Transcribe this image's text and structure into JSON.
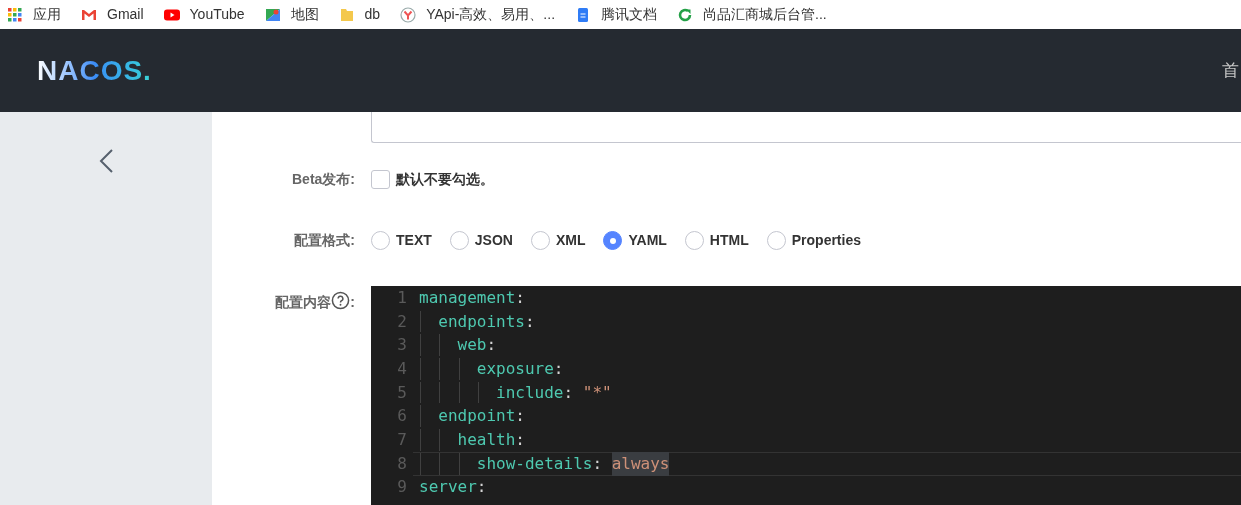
{
  "bookmarks": [
    {
      "label": "应用",
      "kind": "apps"
    },
    {
      "label": "Gmail",
      "kind": "gmail"
    },
    {
      "label": "YouTube",
      "kind": "youtube"
    },
    {
      "label": "地图",
      "kind": "maps"
    },
    {
      "label": "db",
      "kind": "folder"
    },
    {
      "label": "YApi-高效、易用、...",
      "kind": "yapi"
    },
    {
      "label": "腾讯文档",
      "kind": "doc"
    },
    {
      "label": "尚品汇商城后台管...",
      "kind": "refresh"
    }
  ],
  "header": {
    "logo": "NACOS.",
    "nav_item": "首"
  },
  "form": {
    "beta": {
      "label": "Beta发布:",
      "checked": false,
      "hint": "默认不要勾选。"
    },
    "format": {
      "label": "配置格式:",
      "options": [
        {
          "label": "TEXT",
          "selected": false
        },
        {
          "label": "JSON",
          "selected": false
        },
        {
          "label": "XML",
          "selected": false
        },
        {
          "label": "YAML",
          "selected": true
        },
        {
          "label": "HTML",
          "selected": false
        },
        {
          "label": "Properties",
          "selected": false
        }
      ]
    },
    "content": {
      "label": "配置内容",
      "colon": ":",
      "lines": [
        {
          "number": "1",
          "key": "management",
          "colon": ":",
          "current": false
        },
        {
          "number": "2",
          "key": "  endpoints",
          "colon": ":",
          "current": false
        },
        {
          "number": "3",
          "key": "    web",
          "colon": ":",
          "current": false
        },
        {
          "number": "4",
          "key": "      exposure",
          "colon": ":",
          "current": false
        },
        {
          "number": "5",
          "key": "        include",
          "colon": ":",
          "value": "\"*\"",
          "value_selected": false,
          "current": false
        },
        {
          "number": "6",
          "key": "  endpoint",
          "colon": ":",
          "current": false
        },
        {
          "number": "7",
          "key": "    health",
          "colon": ":",
          "current": false
        },
        {
          "number": "8",
          "key": "      show-details",
          "colon": ":",
          "value": "always",
          "value_selected": true,
          "current": true
        },
        {
          "number": "9",
          "key": "server",
          "colon": ":",
          "current": false
        }
      ]
    }
  }
}
